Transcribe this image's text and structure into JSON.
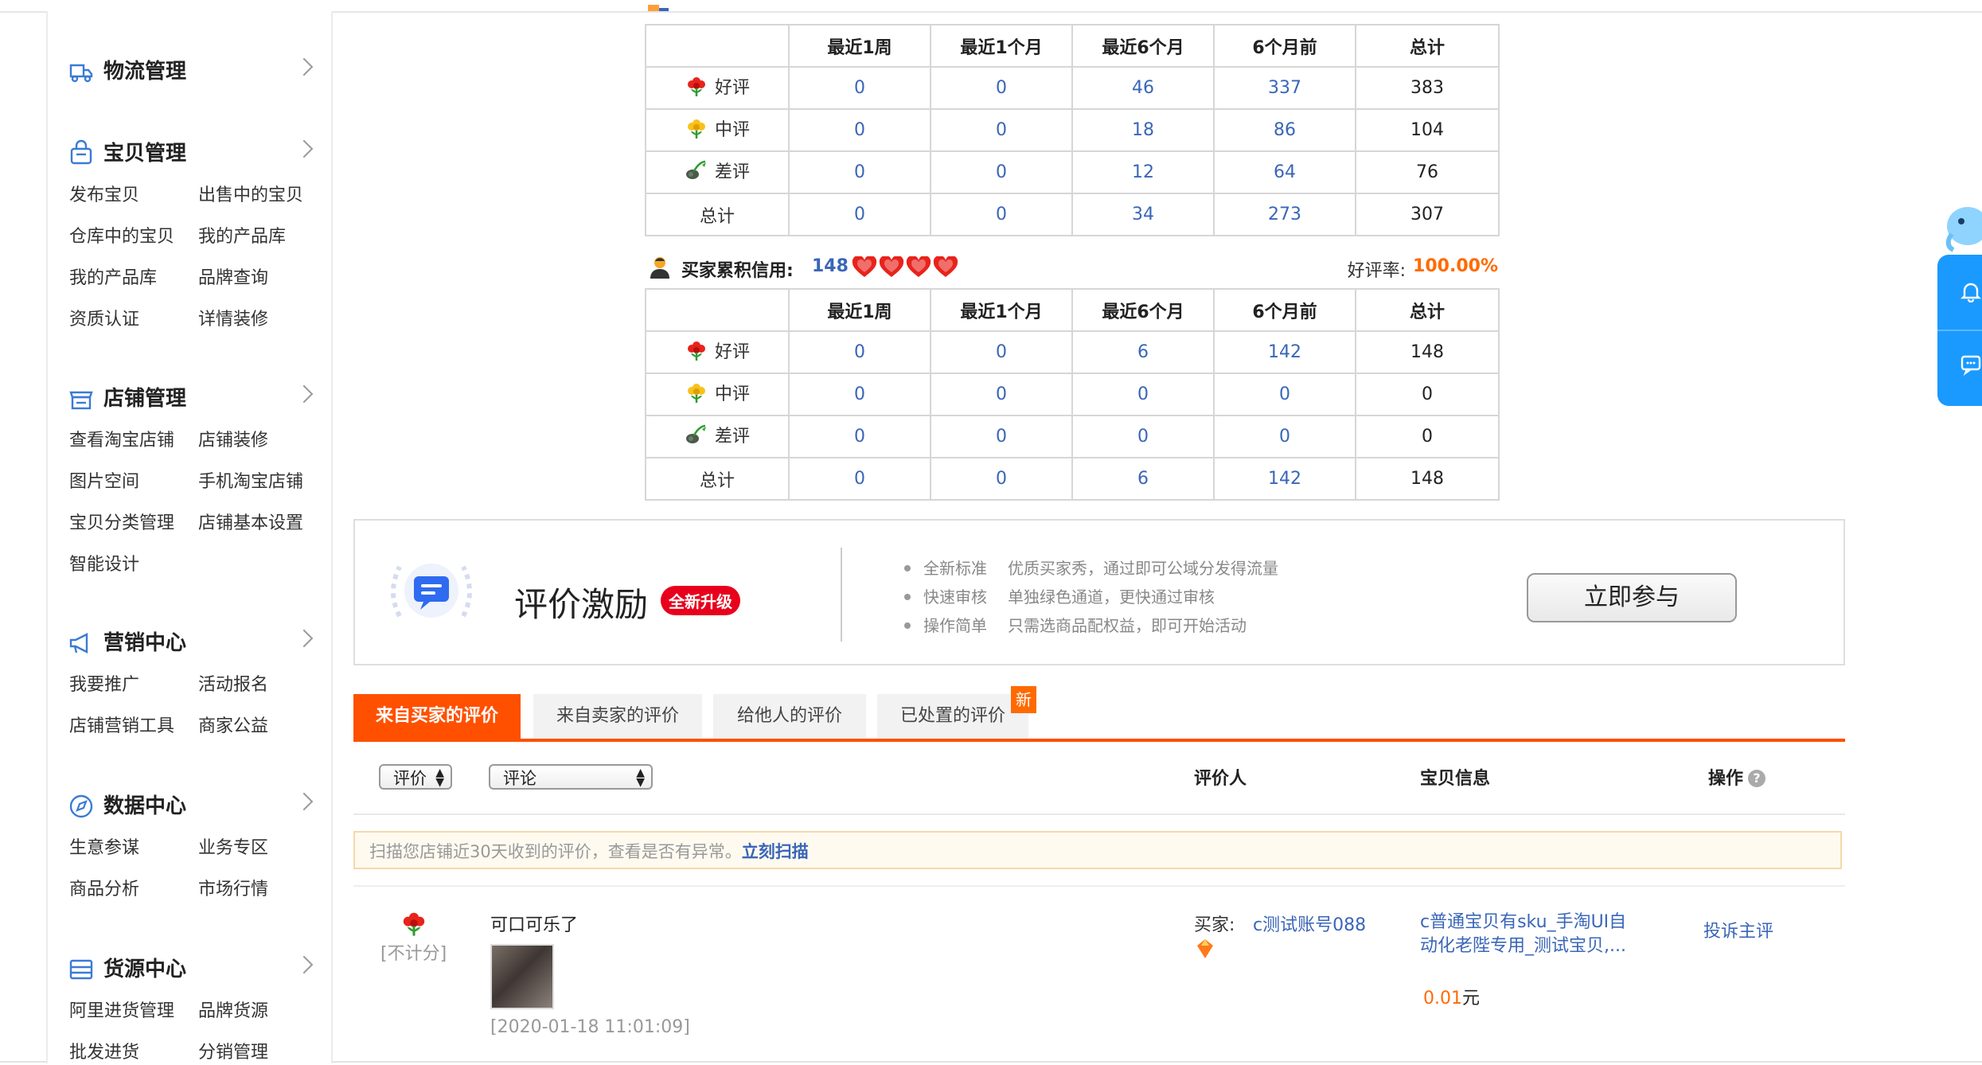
{
  "sidebar": {
    "groups": [
      {
        "title": "物流管理",
        "icon": "truck-icon",
        "items": []
      },
      {
        "title": "宝贝管理",
        "icon": "bag-icon",
        "items": [
          "发布宝贝",
          "出售中的宝贝",
          "仓库中的宝贝",
          "我的产品库",
          "我的产品库",
          "品牌查询",
          "资质认证",
          "详情装修"
        ]
      },
      {
        "title": "店铺管理",
        "icon": "store-icon",
        "items": [
          "查看淘宝店铺",
          "店铺装修",
          "图片空间",
          "手机淘宝店铺",
          "宝贝分类管理",
          "店铺基本设置",
          "智能设计"
        ]
      },
      {
        "title": "营销中心",
        "icon": "megaphone-icon",
        "items": [
          "我要推广",
          "活动报名",
          "店铺营销工具",
          "商家公益"
        ]
      },
      {
        "title": "数据中心",
        "icon": "compass-icon",
        "items": [
          "生意参谋",
          "业务专区",
          "商品分析",
          "市场行情"
        ]
      },
      {
        "title": "货源中心",
        "icon": "box-icon",
        "items": [
          "阿里进货管理",
          "品牌货源",
          "批发进货",
          "分销管理"
        ]
      }
    ]
  },
  "seller_table": {
    "headers": [
      "",
      "最近1周",
      "最近1个月",
      "最近6个月",
      "6个月前",
      "总计"
    ],
    "rows": [
      {
        "label": "好评",
        "icon": "red-flower-icon",
        "values": [
          "0",
          "0",
          "46",
          "337",
          "383"
        ]
      },
      {
        "label": "中评",
        "icon": "yellow-flower-icon",
        "values": [
          "0",
          "0",
          "18",
          "86",
          "104"
        ]
      },
      {
        "label": "差评",
        "icon": "wilted-flower-icon",
        "values": [
          "0",
          "0",
          "12",
          "64",
          "76"
        ]
      },
      {
        "label": "总计",
        "icon": "",
        "values": [
          "0",
          "0",
          "34",
          "273",
          "307"
        ]
      }
    ]
  },
  "buyer_credit": {
    "label": "买家累积信用:",
    "score": "148",
    "hearts": 4,
    "rate_label": "好评率:",
    "rate_value": "100.00%"
  },
  "buyer_table": {
    "headers": [
      "",
      "最近1周",
      "最近1个月",
      "最近6个月",
      "6个月前",
      "总计"
    ],
    "rows": [
      {
        "label": "好评",
        "icon": "red-flower-icon",
        "values": [
          "0",
          "0",
          "6",
          "142",
          "148"
        ]
      },
      {
        "label": "中评",
        "icon": "yellow-flower-icon",
        "values": [
          "0",
          "0",
          "0",
          "0",
          "0"
        ]
      },
      {
        "label": "差评",
        "icon": "wilted-flower-icon",
        "values": [
          "0",
          "0",
          "0",
          "0",
          "0"
        ]
      },
      {
        "label": "总计",
        "icon": "",
        "values": [
          "0",
          "0",
          "6",
          "142",
          "148"
        ]
      }
    ]
  },
  "banner": {
    "title": "评价激励",
    "tag": "全新升级",
    "points": [
      {
        "k": "全新标准",
        "v": "优质买家秀，通过即可公域分发得流量"
      },
      {
        "k": "快速审核",
        "v": "单独绿色通道，更快通过审核"
      },
      {
        "k": "操作简单",
        "v": "只需选商品配权益，即可开始活动"
      }
    ],
    "button": "立即参与"
  },
  "tabs": {
    "items": [
      "来自买家的评价",
      "来自卖家的评价",
      "给他人的评价",
      "已处置的评价"
    ],
    "active": 0,
    "new_badge": "新"
  },
  "filters": {
    "rating_select": "评价",
    "comment_select": "评论",
    "col_reviewer": "评价人",
    "col_item": "宝贝信息",
    "col_action": "操作",
    "help": "?"
  },
  "scan": {
    "text": "扫描您店铺近30天收到的评价，查看是否有异常。",
    "link": "立刻扫描"
  },
  "review": {
    "score_note": "[不计分]",
    "content": "可口可乐了",
    "date": "[2020-01-18 11:01:09]",
    "buyer_label": "买家:",
    "buyer_name": "c测试账号088",
    "item_title": "c普通宝贝有sku_手淘UI自动化老陛专用_测试宝贝,...",
    "price": "0.01",
    "price_unit": "元",
    "action": "投诉主评"
  },
  "colors": {
    "accent_orange": "#ff5000",
    "link_blue": "#3a66b8",
    "float_blue": "#1a9aff",
    "tag_red": "#e8001c"
  }
}
